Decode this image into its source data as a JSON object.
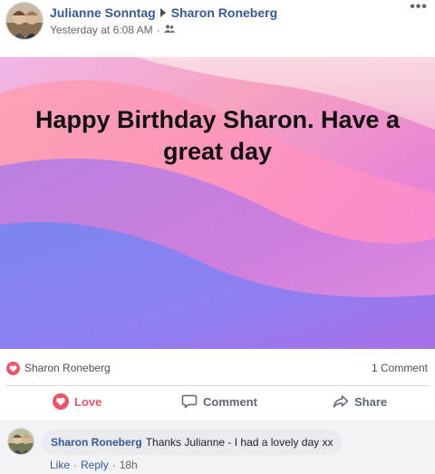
{
  "post": {
    "author": "Julianne Sonntag",
    "recipient": "Sharon Roneberg",
    "time": "Yesterday at 6:08 AM",
    "audience_icon": "friends-icon",
    "more_label": "•••",
    "text": "Happy Birthday Sharon. Have a great day"
  },
  "reactions": {
    "icon": "love-icon",
    "reactor": "Sharon Roneberg",
    "comment_count": "1 Comment"
  },
  "actions": {
    "love": "Love",
    "comment": "Comment",
    "share": "Share"
  },
  "comment": {
    "author": "Sharon Roneberg",
    "text": "Thanks Julianne - I had a lovely day xx",
    "like": "Like",
    "reply": "Reply",
    "separator": "·",
    "age": "18h"
  },
  "colors": {
    "link": "#385898",
    "love": "#e9566a",
    "meta": "#606770"
  }
}
